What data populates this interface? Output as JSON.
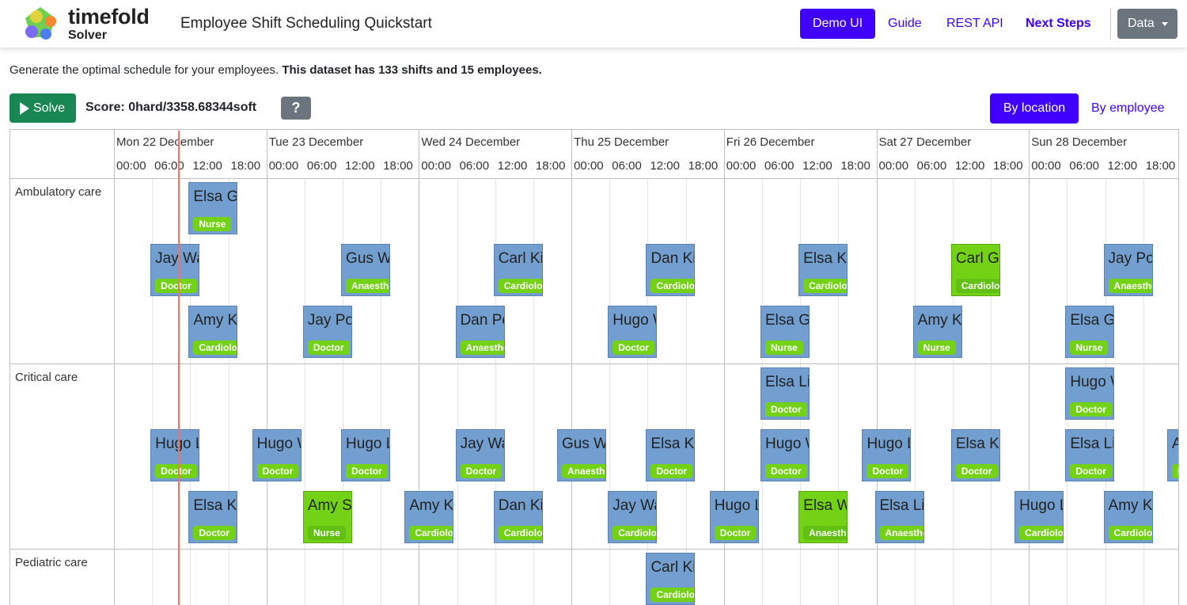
{
  "navbar": {
    "logo_name": "timefold",
    "logo_sub": "Solver",
    "app_title": "Employee Shift Scheduling Quickstart",
    "demo_ui": "Demo UI",
    "guide": "Guide",
    "rest_api": "REST API",
    "next_steps": "Next Steps",
    "data_menu": "Data"
  },
  "intro": {
    "text": "Generate the optimal schedule for your employees. ",
    "bold": "This dataset has 133 shifts and 15 employees."
  },
  "toolbar": {
    "solve": "Solve",
    "score": "Score: 0hard/3358.68344soft",
    "help": "?",
    "by_location": "By location",
    "by_employee": "By employee"
  },
  "timeline": {
    "days": [
      "Mon 22 December",
      "Tue 23 December",
      "Wed 24 December",
      "Thu 25 December",
      "Fri 26 December",
      "Sat 27 December",
      "Sun 28 December"
    ],
    "hours": [
      "00:00",
      "06:00",
      "12:00",
      "18:00"
    ],
    "groups": [
      "Ambulatory care",
      "Critical care",
      "Pediatric care"
    ]
  },
  "shifts": [
    {
      "name": "Elsa Green",
      "skill": "Nurse",
      "group": 0,
      "day": 0,
      "hour": 12,
      "row": 0,
      "assigned": false
    },
    {
      "name": "Jay Watt",
      "skill": "Doctor",
      "group": 0,
      "day": 0,
      "hour": 6,
      "row": 1,
      "assigned": false
    },
    {
      "name": "Gus Watt",
      "skill": "Anaesthetics",
      "group": 0,
      "day": 1,
      "hour": 12,
      "row": 1,
      "assigned": false
    },
    {
      "name": "Carl King",
      "skill": "Cardiology",
      "group": 0,
      "day": 2,
      "hour": 12,
      "row": 1,
      "assigned": false
    },
    {
      "name": "Dan King",
      "skill": "Cardiology",
      "group": 0,
      "day": 3,
      "hour": 12,
      "row": 1,
      "assigned": false
    },
    {
      "name": "Elsa King",
      "skill": "Cardiology",
      "group": 0,
      "day": 4,
      "hour": 12,
      "row": 1,
      "assigned": false
    },
    {
      "name": "Carl Green",
      "skill": "Cardiology",
      "group": 0,
      "day": 5,
      "hour": 12,
      "row": 1,
      "assigned": true
    },
    {
      "name": "Jay Poe",
      "skill": "Anaesthetics",
      "group": 0,
      "day": 6,
      "hour": 12,
      "row": 1,
      "assigned": false
    },
    {
      "name": "Amy King",
      "skill": "Cardiology",
      "group": 0,
      "day": 0,
      "hour": 12,
      "row": 2,
      "assigned": false
    },
    {
      "name": "Jay Poe",
      "skill": "Doctor",
      "group": 0,
      "day": 1,
      "hour": 6,
      "row": 2,
      "assigned": false
    },
    {
      "name": "Dan Poe",
      "skill": "Anaesthetics",
      "group": 0,
      "day": 2,
      "hour": 6,
      "row": 2,
      "assigned": false
    },
    {
      "name": "Hugo Watt",
      "skill": "Doctor",
      "group": 0,
      "day": 3,
      "hour": 6,
      "row": 2,
      "assigned": false
    },
    {
      "name": "Elsa Green",
      "skill": "Nurse",
      "group": 0,
      "day": 4,
      "hour": 6,
      "row": 2,
      "assigned": false
    },
    {
      "name": "Amy King",
      "skill": "Nurse",
      "group": 0,
      "day": 5,
      "hour": 6,
      "row": 2,
      "assigned": false
    },
    {
      "name": "Elsa Green",
      "skill": "Nurse",
      "group": 0,
      "day": 6,
      "hour": 6,
      "row": 2,
      "assigned": false
    },
    {
      "name": "Elsa Li",
      "skill": "Doctor",
      "group": 1,
      "day": 4,
      "hour": 6,
      "row": 0,
      "assigned": false
    },
    {
      "name": "Hugo Watt",
      "skill": "Doctor",
      "group": 1,
      "day": 6,
      "hour": 6,
      "row": 0,
      "assigned": false
    },
    {
      "name": "Hugo Li",
      "skill": "Doctor",
      "group": 1,
      "day": 0,
      "hour": 6,
      "row": 1,
      "assigned": false
    },
    {
      "name": "Hugo Watt",
      "skill": "Doctor",
      "group": 1,
      "day": 0,
      "hour": 22,
      "row": 1,
      "assigned": false
    },
    {
      "name": "Hugo Li",
      "skill": "Doctor",
      "group": 1,
      "day": 1,
      "hour": 12,
      "row": 1,
      "assigned": false
    },
    {
      "name": "Jay Watt",
      "skill": "Doctor",
      "group": 1,
      "day": 2,
      "hour": 6,
      "row": 1,
      "assigned": false
    },
    {
      "name": "Gus Watt",
      "skill": "Anaesthetics",
      "group": 1,
      "day": 2,
      "hour": 22,
      "row": 1,
      "assigned": false
    },
    {
      "name": "Elsa King",
      "skill": "Doctor",
      "group": 1,
      "day": 3,
      "hour": 12,
      "row": 1,
      "assigned": false
    },
    {
      "name": "Hugo Watt",
      "skill": "Doctor",
      "group": 1,
      "day": 4,
      "hour": 6,
      "row": 1,
      "assigned": false
    },
    {
      "name": "Hugo Li",
      "skill": "Doctor",
      "group": 1,
      "day": 4,
      "hour": 22,
      "row": 1,
      "assigned": false
    },
    {
      "name": "Elsa King",
      "skill": "Doctor",
      "group": 1,
      "day": 5,
      "hour": 12,
      "row": 1,
      "assigned": false
    },
    {
      "name": "Elsa Li",
      "skill": "Doctor",
      "group": 1,
      "day": 6,
      "hour": 6,
      "row": 1,
      "assigned": false
    },
    {
      "name": "Amy",
      "skill": "Doctor",
      "group": 1,
      "day": 6,
      "hour": 22,
      "row": 1,
      "assigned": false
    },
    {
      "name": "Elsa King",
      "skill": "Doctor",
      "group": 1,
      "day": 0,
      "hour": 12,
      "row": 2,
      "assigned": false
    },
    {
      "name": "Amy Smith",
      "skill": "Nurse",
      "group": 1,
      "day": 1,
      "hour": 6,
      "row": 2,
      "assigned": true
    },
    {
      "name": "Amy King",
      "skill": "Cardiology",
      "group": 1,
      "day": 1,
      "hour": 22,
      "row": 2,
      "assigned": false
    },
    {
      "name": "Dan King",
      "skill": "Cardiology",
      "group": 1,
      "day": 2,
      "hour": 12,
      "row": 2,
      "assigned": false
    },
    {
      "name": "Jay Watt",
      "skill": "Cardiology",
      "group": 1,
      "day": 3,
      "hour": 6,
      "row": 2,
      "assigned": false
    },
    {
      "name": "Hugo Li",
      "skill": "Doctor",
      "group": 1,
      "day": 3,
      "hour": 22,
      "row": 2,
      "assigned": false
    },
    {
      "name": "Elsa Watt",
      "skill": "Anaesthetics",
      "group": 1,
      "day": 4,
      "hour": 12,
      "row": 2,
      "assigned": true
    },
    {
      "name": "Elsa Li",
      "skill": "Anaesthetics",
      "group": 1,
      "day": 5,
      "hour": 0,
      "row": 2,
      "assigned": false
    },
    {
      "name": "Hugo Li",
      "skill": "Cardiology",
      "group": 1,
      "day": 5,
      "hour": 22,
      "row": 2,
      "assigned": false
    },
    {
      "name": "Amy King",
      "skill": "Cardiology",
      "group": 1,
      "day": 6,
      "hour": 12,
      "row": 2,
      "assigned": false
    },
    {
      "name": "Carl King",
      "skill": "Cardiology",
      "group": 2,
      "day": 3,
      "hour": 12,
      "row": 0,
      "assigned": false
    }
  ],
  "colors": {
    "primary": "#3f00ff",
    "solve": "#198754",
    "secondary": "#6c757d",
    "shift": "#729fcf",
    "shift_assigned": "#73d216",
    "skill_badge": "#73d216",
    "now_line": "#f47264"
  }
}
